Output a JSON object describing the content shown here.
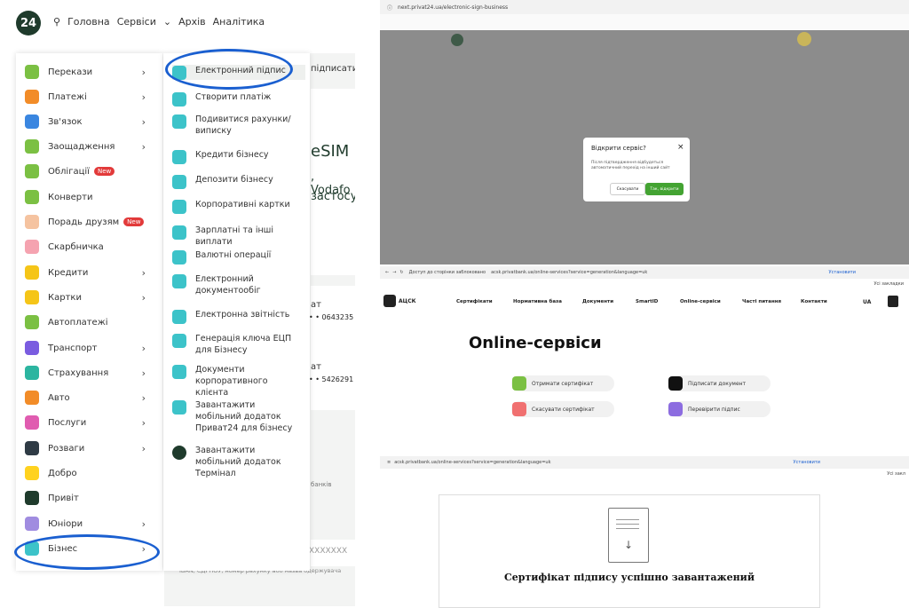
{
  "left": {
    "logo": "24",
    "nav": [
      "Головна",
      "Сервіси",
      "Архів",
      "Аналітика"
    ],
    "bg_texts": {
      "sign_label": "підписати",
      "esim": "eSIM",
      "vodafone": ", Vodafo",
      "app": "застосун",
      "card1": "ат",
      "card1_num": "• • 0643235",
      "card2": "ат",
      "card2_num": "• • 5426291",
      "banks": "банків",
      "xxx": "XXXXXXX",
      "search_hint": "IBAN, ЄДРПОУ, номер рахунку або назва одержувача"
    },
    "menu1": [
      {
        "label": "Перекази",
        "chevron": true,
        "color": "#7bc043"
      },
      {
        "label": "Платежі",
        "chevron": true,
        "color": "#f28c28"
      },
      {
        "label": "Зв'язок",
        "chevron": true,
        "color": "#3a86e0"
      },
      {
        "label": "Заощадження",
        "chevron": true,
        "color": "#7bc043"
      },
      {
        "label": "Облігації",
        "badge": "New",
        "color": "#7bc043"
      },
      {
        "label": "Конверти",
        "color": "#7bc043"
      },
      {
        "label": "Порадь друзям",
        "badge": "New",
        "color": "#f5c3a0"
      },
      {
        "label": "Скарбничка",
        "color": "#f5a3b0"
      },
      {
        "label": "Кредити",
        "chevron": true,
        "color": "#f5c518"
      },
      {
        "label": "Картки",
        "chevron": true,
        "color": "#f5c518"
      },
      {
        "label": "Автоплатежі",
        "color": "#7bc043"
      },
      {
        "label": "Транспорт",
        "chevron": true,
        "color": "#7a5ce0"
      },
      {
        "label": "Страхування",
        "chevron": true,
        "color": "#2cb5a0"
      },
      {
        "label": "Авто",
        "chevron": true,
        "color": "#f28c28"
      },
      {
        "label": "Послуги",
        "chevron": true,
        "color": "#e05cb0"
      },
      {
        "label": "Розваги",
        "chevron": true,
        "color": "#2f3b45"
      },
      {
        "label": "Добро",
        "color": "#ffd21f"
      },
      {
        "label": "Привіт",
        "color": "#1f3b2c"
      },
      {
        "label": "Юніори",
        "chevron": true,
        "color": "#a08ce0"
      },
      {
        "label": "Бізнес",
        "chevron": true,
        "color": "#3cc3c9"
      }
    ],
    "menu2": [
      "Електронний підпис",
      "Створити платіж",
      "Подивитися рахунки/ виписку",
      "Кредити бізнесу",
      "Депозити бізнесу",
      "Корпоративні картки",
      "Зарплатні та інші виплати",
      "Валютні операції",
      "Електронний документообіг",
      "Електронна звітність",
      "Генерація ключа ЕЦП для Бізнесу",
      "Документи корпоративного клієнта",
      "Завантажити мобільний додаток Приват24 для бізнесу",
      "Завантажити мобільний додаток Термінал"
    ]
  },
  "right_top": {
    "url": "next.privat24.ua/electronic-sign-business",
    "dialog": {
      "title": "Відкрити сервіс?",
      "body": "Після підтвердження відбудеться автоматичний перехід на інший сайт",
      "cancel": "Скасувати",
      "confirm": "Так, відкрити"
    }
  },
  "right_mid": {
    "warning": "Доступ до сторінки заблоковано",
    "url": "acsk.privatbank.ua/online-services?service=generation&language=uk",
    "install": "Установити",
    "bookmarks": "Усі закладки",
    "logo": "АЦСК",
    "nav": [
      "Сертифікати",
      "Нормативна база",
      "Документи",
      "SmartID",
      "Online-сервіси",
      "Часті питання",
      "Контакти"
    ],
    "lang": "UA",
    "title": "Online-сервіси",
    "services": [
      {
        "label": "Отримати сертифікат",
        "color": "#7bc043"
      },
      {
        "label": "Підписати документ",
        "color": "#111111"
      },
      {
        "label": "Скасувати сертифікат",
        "color": "#f07070"
      },
      {
        "label": "Перевірити підпис",
        "color": "#8c6ce0"
      }
    ]
  },
  "right_bot": {
    "url": "acsk.privatbank.ua/online-services?service=generation&language=uk",
    "install": "Установити",
    "bookmarks": "Усі закл",
    "heading": "Сертифікат підпису успішно завантажений"
  }
}
